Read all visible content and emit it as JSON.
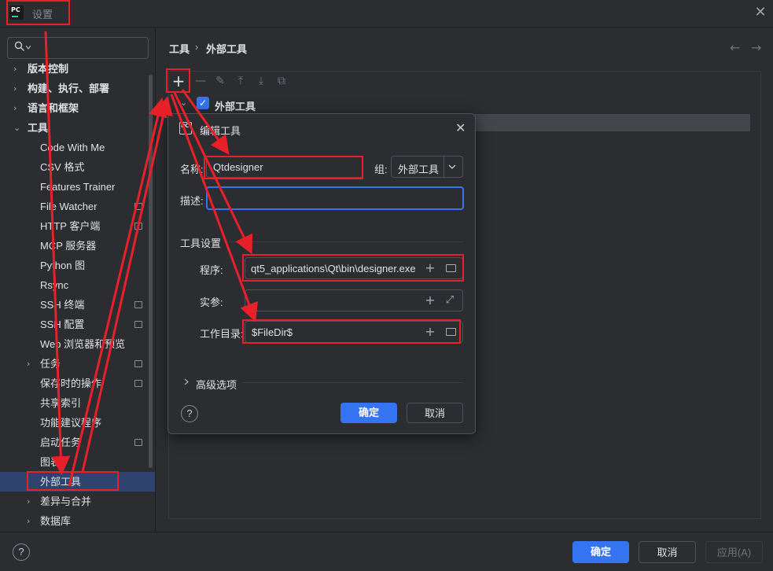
{
  "window": {
    "title": "设置"
  },
  "search": {
    "placeholder": ""
  },
  "sidebar": {
    "items": [
      {
        "label": "版本控制",
        "chevron": "›",
        "bold": true,
        "indent": 1
      },
      {
        "label": "构建、执行、部署",
        "chevron": "›",
        "bold": true,
        "indent": 1
      },
      {
        "label": "语言和框架",
        "chevron": "›",
        "bold": true,
        "indent": 1
      },
      {
        "label": "工具",
        "chevron": "⌄",
        "bold": true,
        "indent": 1
      },
      {
        "label": "Code With Me",
        "indent": 2
      },
      {
        "label": "CSV 格式",
        "indent": 2
      },
      {
        "label": "Features Trainer",
        "indent": 2
      },
      {
        "label": "File Watcher",
        "indent": 2,
        "badge": true
      },
      {
        "label": "HTTP 客户端",
        "indent": 2,
        "badge": true
      },
      {
        "label": "MCP 服务器",
        "indent": 2
      },
      {
        "label": "Python 图",
        "indent": 2
      },
      {
        "label": "Rsync",
        "indent": 2
      },
      {
        "label": "SSH 终端",
        "indent": 2,
        "badge": true
      },
      {
        "label": "SSH 配置",
        "indent": 2,
        "badge": true
      },
      {
        "label": "Web 浏览器和预览",
        "indent": 2
      },
      {
        "label": "任务",
        "chevron": "›",
        "indent": 2,
        "badge": true
      },
      {
        "label": "保存时的操作",
        "indent": 2,
        "badge": true
      },
      {
        "label": "共享索引",
        "indent": 2
      },
      {
        "label": "功能建议程序",
        "indent": 2
      },
      {
        "label": "启动任务",
        "indent": 2,
        "badge": true
      },
      {
        "label": "图表",
        "indent": 2
      },
      {
        "label": "外部工具",
        "indent": 2,
        "selected": true
      },
      {
        "label": "差异与合并",
        "chevron": "›",
        "indent": 2
      },
      {
        "label": "数据库",
        "chevron": "›",
        "indent": 2
      }
    ]
  },
  "breadcrumb": {
    "root": "工具",
    "separator": "›",
    "current": "外部工具"
  },
  "toolbar": {
    "add": "+",
    "remove": "—",
    "edit": "✎",
    "move_up": "⤒",
    "move_down": "⤓",
    "copy": "⧉"
  },
  "tool_group": {
    "label": "外部工具",
    "checked": true
  },
  "dialog": {
    "title": "编辑工具",
    "icon_text": "PC",
    "name_label": "名称:",
    "name_value": "Qtdesigner",
    "group_label": "组:",
    "group_value": "外部工具",
    "description_label": "描述:",
    "description_value": "",
    "settings_section": "工具设置",
    "program_label": "程序:",
    "program_value": "qt5_applications\\Qt\\bin\\designer.exe",
    "args_label": "实参:",
    "args_value": "",
    "workdir_label": "工作目录:",
    "workdir_value": "$FileDir$",
    "advanced_label": "高级选项",
    "ok_label": "确定",
    "cancel_label": "取消",
    "help": "?"
  },
  "footer": {
    "ok_label": "确定",
    "cancel_label": "取消",
    "apply_label": "应用(A)",
    "help": "?"
  },
  "colors": {
    "accent": "#3574f0",
    "annotation": "#e8202a",
    "background": "#2b2d30",
    "selection": "#2e436e"
  }
}
